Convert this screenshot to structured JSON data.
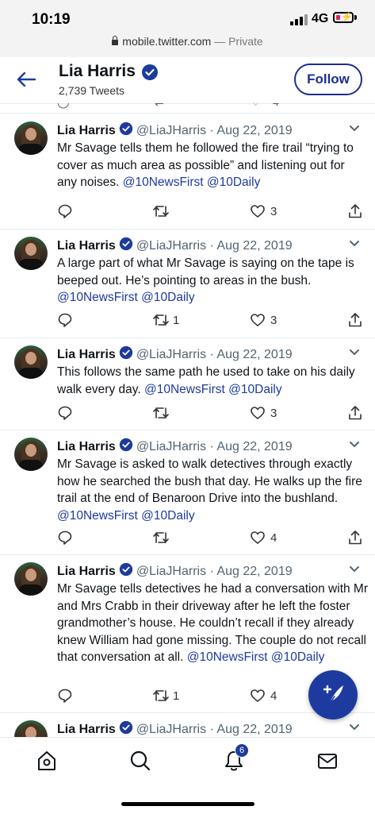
{
  "status": {
    "time": "10:19",
    "network": "4G"
  },
  "browser": {
    "url": "mobile.twitter.com",
    "private": " — Private"
  },
  "header": {
    "name": "Lia Harris",
    "tweet_count": "2,739 Tweets",
    "follow_label": "Follow"
  },
  "prev_tweet": {
    "like_count": "4"
  },
  "tweets": [
    {
      "name": "Lia Harris",
      "handle": "@LiaJHarris",
      "date": "Aug 22, 2019",
      "text": "Mr Savage tells them he followed the fire trail “trying to cover as much area as possible” and listening out for any noises. ",
      "mentions": "@10NewsFirst @10Daily",
      "retweets": "",
      "likes": "3"
    },
    {
      "name": "Lia Harris",
      "handle": "@LiaJHarris",
      "date": "Aug 22, 2019",
      "text": "A large part of what Mr Savage is saying on the tape is beeped out. He’s pointing to areas in the bush. ",
      "mentions": "@10NewsFirst @10Daily",
      "retweets": "1",
      "likes": "3"
    },
    {
      "name": "Lia Harris",
      "handle": "@LiaJHarris",
      "date": "Aug 22, 2019",
      "text": "This follows the same path he used to take on his daily walk every day. ",
      "mentions": "@10NewsFirst @10Daily",
      "retweets": "",
      "likes": "3"
    },
    {
      "name": "Lia Harris",
      "handle": "@LiaJHarris",
      "date": "Aug 22, 2019",
      "text": "Mr Savage is asked to walk detectives through exactly how he searched the bush that day. He walks up the fire trail at the end of Benaroon Drive into the bushland. ",
      "mentions": "@10NewsFirst @10Daily",
      "retweets": "",
      "likes": "4"
    },
    {
      "name": "Lia Harris",
      "handle": "@LiaJHarris",
      "date": "Aug 22, 2019",
      "text": "Mr Savage tells detectives he had a conversation with Mr and Mrs Crabb in their driveway after he left the foster grandmother’s house. He couldn’t recall if they already knew William had gone missing. The couple do not recall that conversation at all. ",
      "mentions": "@10NewsFirst @10Daily",
      "retweets": "1",
      "likes": "4"
    },
    {
      "name": "Lia Harris",
      "handle": "@LiaJHarris",
      "date": "Aug 22, 2019"
    }
  ],
  "tabbar": {
    "notification_badge": "6"
  },
  "icons": [
    "back-arrow-icon",
    "verified-icon",
    "reply-icon",
    "retweet-icon",
    "like-icon",
    "share-icon",
    "chevron-down-icon",
    "home-icon",
    "search-icon",
    "bell-icon",
    "mail-icon",
    "compose-icon"
  ],
  "colors": {
    "brand": "#1d3b9f",
    "text": "#0f1419",
    "meta": "#536471"
  }
}
